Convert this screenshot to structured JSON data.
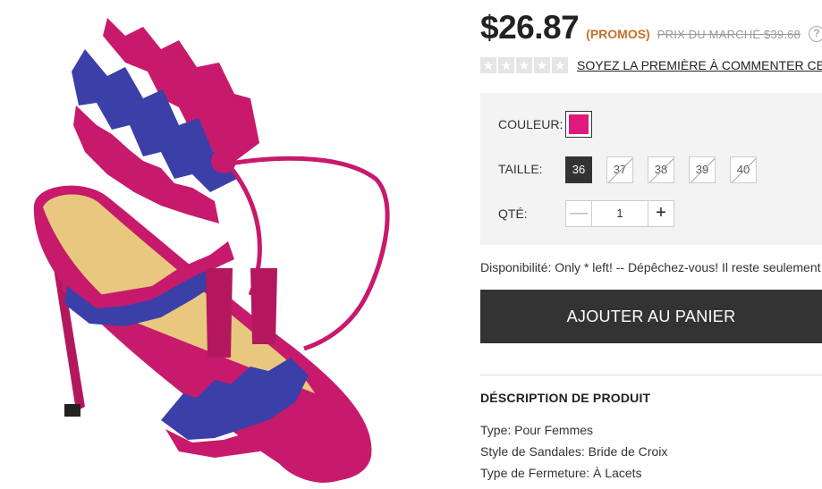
{
  "product": {
    "image_alt": "Sandales à talon aiguille fuchsia avec motif zigzag bleu et lacets à glands"
  },
  "price": {
    "current": "$26.87",
    "promo_tag": "(PROMOS)",
    "market_label": "PRIX DU MARCHÉ $39.68",
    "help_icon": "?"
  },
  "rating": {
    "stars": [
      "★",
      "★",
      "★",
      "★",
      "★"
    ],
    "review_link": "SOYEZ LA PREMIÈRE À COMMENTER CET ARTICLE"
  },
  "options": {
    "color_label": "COULEUR:",
    "selected_color": "#e0197d",
    "size_label": "TAILLE:",
    "sizes": [
      {
        "label": "36",
        "state": "selected"
      },
      {
        "label": "37",
        "state": "disabled"
      },
      {
        "label": "38",
        "state": "disabled"
      },
      {
        "label": "39",
        "state": "disabled"
      },
      {
        "label": "40",
        "state": "disabled"
      }
    ],
    "qty_label": "QTÉ:",
    "qty_minus": "—",
    "qty_value": "1",
    "qty_plus": "+"
  },
  "availability": "Disponibilité: Only * left! -- Dépêchez-vous! Il reste seulement",
  "cart": {
    "add_label": "AJOUTER AU PANIER"
  },
  "description": {
    "title": "DÉSCRIPTION DE PRODUIT",
    "specs": [
      "Type: Pour Femmes",
      "Style de Sandales: Bride de Croix",
      "Type de Fermeture: À Lacets"
    ]
  }
}
